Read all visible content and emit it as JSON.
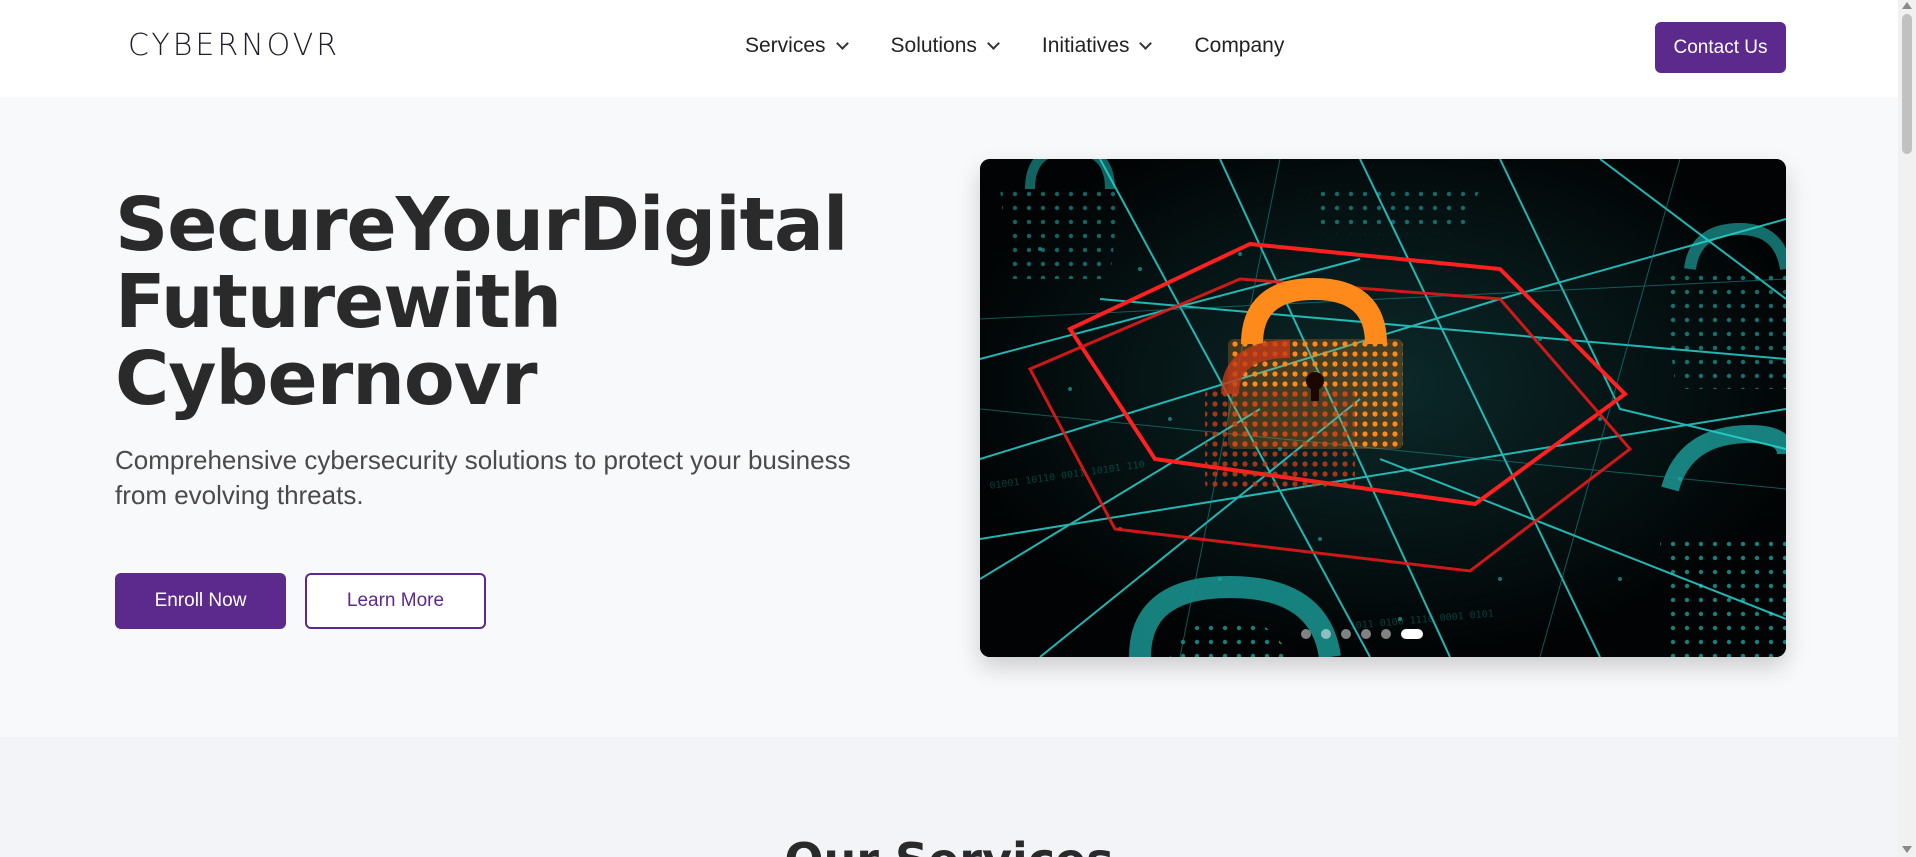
{
  "header": {
    "logo_text": "CYBERNOVR",
    "nav": [
      {
        "label": "Services",
        "has_dropdown": true
      },
      {
        "label": "Solutions",
        "has_dropdown": true
      },
      {
        "label": "Initiatives",
        "has_dropdown": true
      },
      {
        "label": "Company",
        "has_dropdown": false
      }
    ],
    "contact_label": "Contact Us"
  },
  "hero": {
    "title_lines": [
      "SecureYourDigital",
      "Futurewith",
      "Cybernovr"
    ],
    "subtitle": "Comprehensive cybersecurity solutions to protect your business from evolving threats.",
    "enroll_label": "Enroll Now",
    "learn_label": "Learn More",
    "carousel": {
      "slide_count": 6,
      "active_index": 5
    }
  },
  "services": {
    "title": "Our Services"
  },
  "colors": {
    "brand": "#5b2a8c",
    "background": "#f8f9fb",
    "text": "#2a2a2a"
  }
}
